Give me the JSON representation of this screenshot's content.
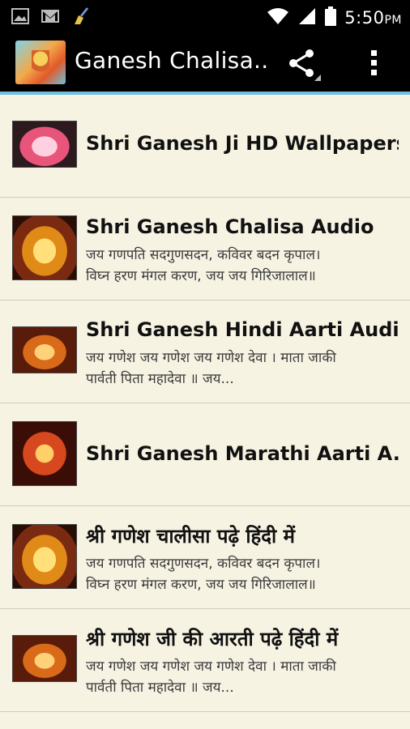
{
  "status_bar": {
    "time": "5:50",
    "ampm": "PM",
    "icons": [
      "image-icon",
      "gmail-icon",
      "broom-icon",
      "wifi-icon",
      "signal-icon",
      "battery-icon"
    ]
  },
  "action_bar": {
    "title": "Ganesh Chalisa..",
    "actions": [
      "share-icon",
      "overflow-menu-icon"
    ]
  },
  "colors": {
    "accent": "#6fbfe0",
    "background": "#f7f3e3",
    "bar": "#000000"
  },
  "items": [
    {
      "title": "Shri Ganesh Ji HD Wallpapers",
      "line1": "",
      "line2": ""
    },
    {
      "title": "Shri Ganesh Chalisa Audio",
      "line1": "जय गणपति सदगुणसदन, कविवर बदन कृपाल।",
      "line2": "विघ्न हरण मंगल करण, जय जय गिरिजालाल॥"
    },
    {
      "title": "Shri Ganesh Hindi Aarti Audio",
      "line1": "जय गणेश जय गणेश जय गणेश देवा । माता जाकी",
      "line2": "पार्वती पिता महादेवा ॥ जय..."
    },
    {
      "title": "Shri Ganesh Marathi Aarti A...",
      "line1": "",
      "line2": ""
    },
    {
      "title": "श्री गणेश चालीसा पढ़े हिंदी में",
      "line1": "जय गणपति सदगुणसदन, कविवर बदन कृपाल।",
      "line2": "विघ्न हरण मंगल करण, जय जय गिरिजालाल॥"
    },
    {
      "title": "श्री गणेश जी की आरती पढ़े हिंदी में",
      "line1": "जय गणेश जय गणेश जय गणेश देवा । माता जाकी",
      "line2": "पार्वती पिता महादेवा ॥ जय..."
    }
  ]
}
